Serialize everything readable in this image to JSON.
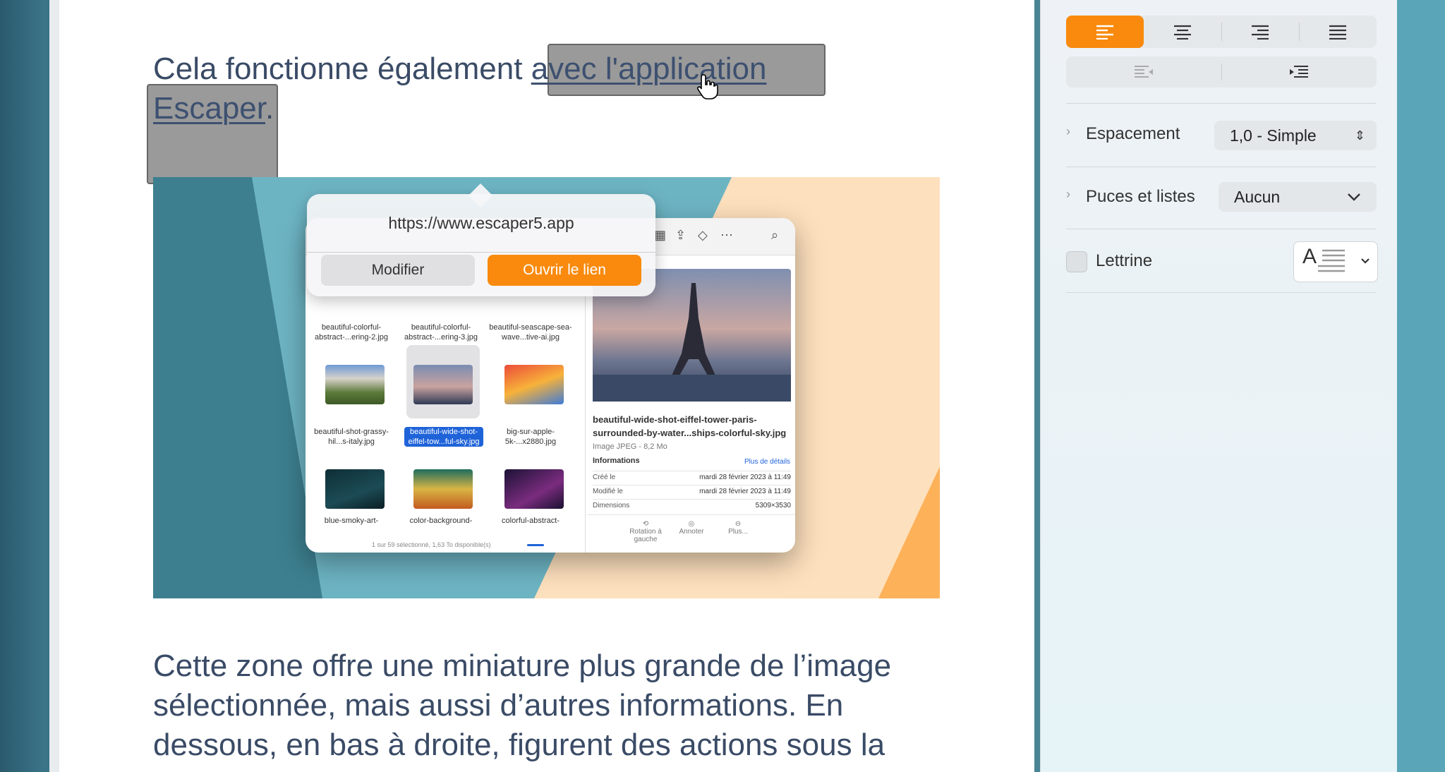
{
  "document": {
    "para1_prefix": "Cela fonctionne également ",
    "para1_link_a": "avec l'application",
    "para1_link_b": "Escaper",
    "para1_suffix": ".",
    "para2": "Cette zone offre une miniature plus grande de l’image sélectionnée, mais aussi d’autres informations. En dessous, en bas à droite, figurent des actions sous la"
  },
  "popover": {
    "url": "https://www.escaper5.app",
    "edit_label": "Modifier",
    "open_label": "Ouvrir le lien"
  },
  "finder": {
    "thumbnails": [
      {
        "label": "beautiful-colorful-abstract-...ering-2.jpg",
        "selected": false
      },
      {
        "label": "beautiful-colorful-abstract-...ering-3.jpg",
        "selected": false
      },
      {
        "label": "beautiful-seascape-sea-wave...tive-ai.jpg",
        "selected": false
      },
      {
        "label": "beautiful-shot-grassy-hil...s-italy.jpg",
        "selected": false
      },
      {
        "label": "beautiful-wide-shot-eiffel-tow...ful-sky.jpg",
        "selected": true
      },
      {
        "label": "big-sur-apple-5k-...x2880.jpg",
        "selected": false
      },
      {
        "label": "blue-smoky-art-",
        "selected": false
      },
      {
        "label": "color-background-",
        "selected": false
      },
      {
        "label": "colorful-abstract-",
        "selected": false
      }
    ],
    "status": "1 sur 59 sélectionné, 1,63 To disponible(s)",
    "preview": {
      "title": "beautiful-wide-shot-eiffel-tower-paris-surrounded-by-water...ships-colorful-sky.jpg",
      "subtitle": "Image JPEG - 8,2 Mo",
      "info_heading": "Informations",
      "more_link": "Plus de détails",
      "rows": [
        {
          "key": "Créé le",
          "value": "mardi 28 février 2023 à 11:49"
        },
        {
          "key": "Modifié le",
          "value": "mardi 28 février 2023 à 11:49"
        },
        {
          "key": "Dimensions",
          "value": "5309×3530"
        }
      ],
      "actions": [
        "Rotation à gauche",
        "Annoter",
        "Plus..."
      ]
    }
  },
  "sidebar": {
    "spacing_label": "Espacement",
    "spacing_value": "1,0 - Simple",
    "bullets_label": "Puces et listes",
    "bullets_value": "Aucun",
    "dropcap_label": "Lettrine",
    "dropcap_preview": "A"
  },
  "colors": {
    "accent": "#f98a0d",
    "text": "#3a4b66",
    "selection_blue": "#1f63d9"
  }
}
